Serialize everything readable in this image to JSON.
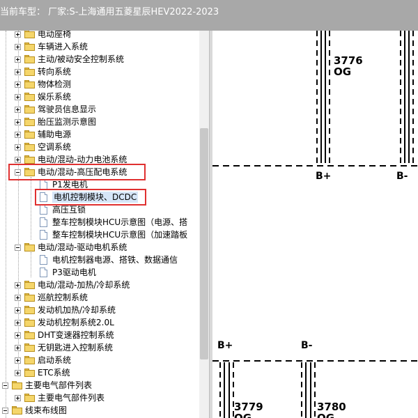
{
  "window": {
    "title": "当前车型： 厂家:S-上海通用五菱星辰HEV2022-2023"
  },
  "tree": {
    "items": [
      {
        "label": "电动座椅",
        "type": "folder",
        "expander": "plus"
      },
      {
        "label": "车辆进入系统",
        "type": "folder",
        "expander": "plus"
      },
      {
        "label": "主动/被动安全控制系统",
        "type": "folder",
        "expander": "plus"
      },
      {
        "label": "转向系统",
        "type": "folder",
        "expander": "plus"
      },
      {
        "label": "物体检测",
        "type": "folder",
        "expander": "plus"
      },
      {
        "label": "娱乐系统",
        "type": "folder",
        "expander": "plus"
      },
      {
        "label": "驾驶员信息显示",
        "type": "folder",
        "expander": "plus"
      },
      {
        "label": "胎压监测示意图",
        "type": "folder",
        "expander": "plus"
      },
      {
        "label": "辅助电源",
        "type": "folder",
        "expander": "plus"
      },
      {
        "label": "空调系统",
        "type": "folder",
        "expander": "plus"
      },
      {
        "label": "电动/混动-动力电池系统",
        "type": "folder",
        "expander": "plus"
      },
      {
        "label": "电动/混动-高压配电系统",
        "type": "folder",
        "expander": "minus"
      },
      {
        "label": "P1发电机",
        "type": "doc"
      },
      {
        "label": "电机控制模块、DCDC",
        "type": "doc",
        "selected": true
      },
      {
        "label": "高压互锁",
        "type": "doc"
      },
      {
        "label": "整车控制模块HCU示意图（电源、搭",
        "type": "doc"
      },
      {
        "label": "整车控制模块HCU示意图（加速踏板",
        "type": "doc"
      },
      {
        "label": "电动/混动-驱动电机系统",
        "type": "folder",
        "expander": "minus"
      },
      {
        "label": "电机控制器电源、搭铁、数据通信",
        "type": "doc"
      },
      {
        "label": "P3驱动电机",
        "type": "doc"
      },
      {
        "label": "电动/混动-加热/冷却系统",
        "type": "folder",
        "expander": "plus"
      },
      {
        "label": "巡航控制系统",
        "type": "folder",
        "expander": "plus"
      },
      {
        "label": "发动机加热/冷却系统",
        "type": "folder",
        "expander": "plus"
      },
      {
        "label": "发动机控制系统2.0L",
        "type": "folder",
        "expander": "plus"
      },
      {
        "label": "DHT变速器控制系统",
        "type": "folder",
        "expander": "plus"
      },
      {
        "label": "无钥匙进入控制系统",
        "type": "folder",
        "expander": "plus"
      },
      {
        "label": "启动系统",
        "type": "folder",
        "expander": "plus"
      },
      {
        "label": "ETC系统",
        "type": "folder",
        "expander": "plus"
      },
      {
        "label": "主要电气部件列表",
        "type": "folder",
        "expander": "minus"
      },
      {
        "label": "主要电气部件列表",
        "type": "folder",
        "expander": "plus"
      },
      {
        "label": "线束布线图",
        "type": "folder",
        "expander": "minus"
      }
    ]
  },
  "diagram": {
    "wires": [
      {
        "number": "3776",
        "color": "OG"
      },
      {
        "number": "3779",
        "color": "OG"
      },
      {
        "number": "3780",
        "color": "OG"
      }
    ],
    "pins": {
      "top_left": "B+",
      "top_right": "B-",
      "bottom_left": "B+",
      "bottom_right": "B-"
    }
  }
}
